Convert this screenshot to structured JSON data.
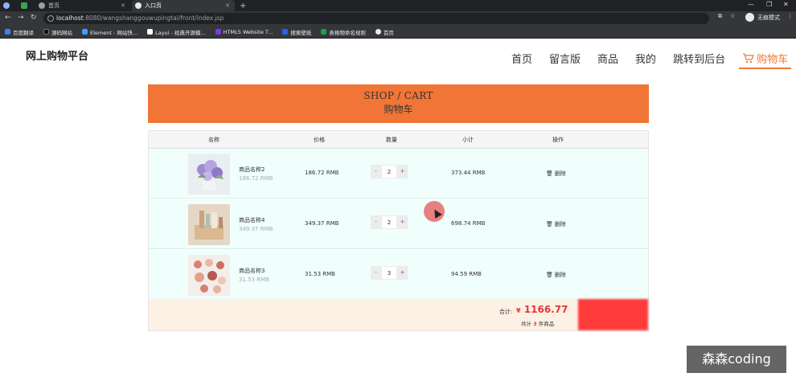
{
  "browser": {
    "tabs": [
      {
        "label": ""
      },
      {
        "label": ""
      },
      {
        "label": "首页"
      },
      {
        "label": "入口页"
      }
    ],
    "new_tab": "+",
    "url_host": "localhost",
    "url_path": ":8080/wangshanggouwupingtai/front/index.jsp",
    "profile": "无痕模式",
    "bookmarks": [
      {
        "label": "百度翻译",
        "color": "#3b82f6"
      },
      {
        "label": "源码网站",
        "color": "#111111"
      },
      {
        "label": "Element - 网站快...",
        "color": "#409eff"
      },
      {
        "label": "Layui - 经典开源模...",
        "color": "#ffffff"
      },
      {
        "label": "HTML5 Website T...",
        "color": "#7c3aed"
      },
      {
        "label": "搜索壁纸",
        "color": "#2563eb"
      },
      {
        "label": "表格物命名规则",
        "color": "#16a34a"
      },
      {
        "label": "首页",
        "color": "#e8eaed"
      }
    ]
  },
  "site": {
    "logo": "网上购物平台",
    "nav": [
      "首页",
      "留言版",
      "商品",
      "我的",
      "跳转到后台"
    ],
    "cart_nav": "购物车",
    "accent": "#f07a2f"
  },
  "banner": {
    "title_en": "SHOP / CART",
    "title_cn": "购物车"
  },
  "table": {
    "headers": {
      "name": "名称",
      "price": "价格",
      "qty": "数量",
      "subtotal": "小计",
      "action": "操作"
    },
    "rows": [
      {
        "name": "商品名称2",
        "unit": "186.72 RMB",
        "price": "186.72 RMB",
        "qty": "2",
        "subtotal": "373.44 RMB",
        "delete": "删除",
        "image": "purple-flowers"
      },
      {
        "name": "商品名称4",
        "unit": "349.37 RMB",
        "price": "349.37 RMB",
        "qty": "2",
        "subtotal": "698.74 RMB",
        "delete": "删除",
        "image": "cosmetics-box"
      },
      {
        "name": "商品名称3",
        "unit": "31.53 RMB",
        "price": "31.53 RMB",
        "qty": "3",
        "subtotal": "94.59 RMB",
        "delete": "删除",
        "image": "makeup-palette"
      }
    ],
    "minus": "-",
    "plus": "+"
  },
  "summary": {
    "total_label": "合计:",
    "currency": "¥",
    "total": "1166.77",
    "count_prefix": "共计",
    "count": "3",
    "count_suffix": "件商品"
  },
  "watermark": "森森coding"
}
